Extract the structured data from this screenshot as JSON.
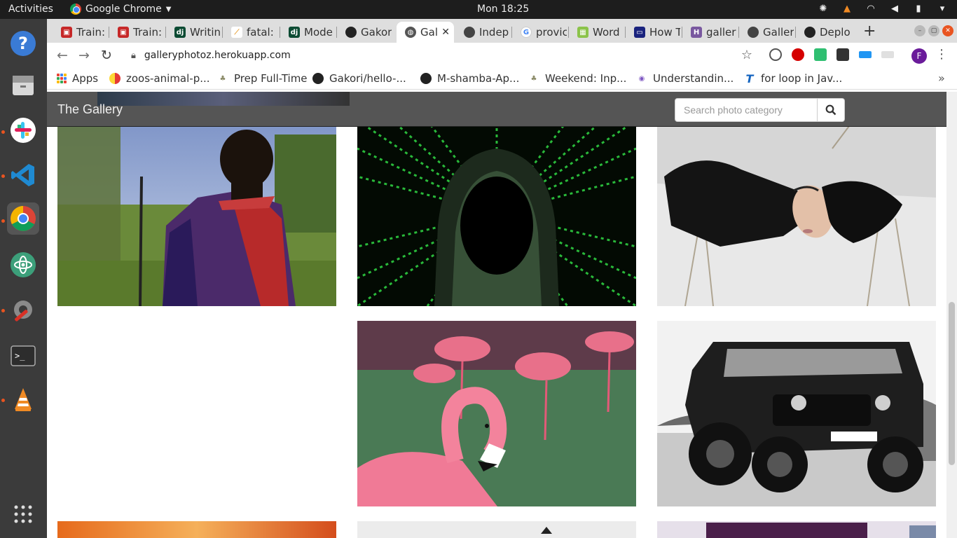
{
  "system_bar": {
    "activities": "Activities",
    "app_name": "Google Chrome",
    "clock": "Mon 18:25"
  },
  "tabs": [
    {
      "label": "Train:",
      "favicon": "red"
    },
    {
      "label": "Train:",
      "favicon": "red"
    },
    {
      "label": "Writin",
      "favicon": "dj"
    },
    {
      "label": "fatal:",
      "favicon": "git"
    },
    {
      "label": "Mode",
      "favicon": "dj"
    },
    {
      "label": "Gakor",
      "favicon": "github"
    },
    {
      "label": "Gal",
      "favicon": "globe",
      "active": true
    },
    {
      "label": "Indep",
      "favicon": "github"
    },
    {
      "label": "provic",
      "favicon": "google"
    },
    {
      "label": "Word",
      "favicon": "img"
    },
    {
      "label": "How T",
      "favicon": "dev"
    },
    {
      "label": "galler",
      "favicon": "heroku"
    },
    {
      "label": "Galler",
      "favicon": "github"
    },
    {
      "label": "Deplo",
      "favicon": "github"
    }
  ],
  "address_bar": {
    "url": "galleryphotoz.herokuapp.com"
  },
  "bookmarks": [
    {
      "label": "Apps"
    },
    {
      "label": "zoos-animal-p..."
    },
    {
      "label": "Prep Full-Time"
    },
    {
      "label": "Gakori/hello-..."
    },
    {
      "label": "M-shamba-Ap..."
    },
    {
      "label": "Weekend: Inp..."
    },
    {
      "label": "Understandin..."
    },
    {
      "label": "for loop in Jav..."
    }
  ],
  "profile_initial": "F",
  "page": {
    "brand": "The Gallery",
    "search_placeholder": "Search photo category"
  },
  "colors": {
    "navbar": "#555555",
    "accent_orange": "#e95420"
  }
}
